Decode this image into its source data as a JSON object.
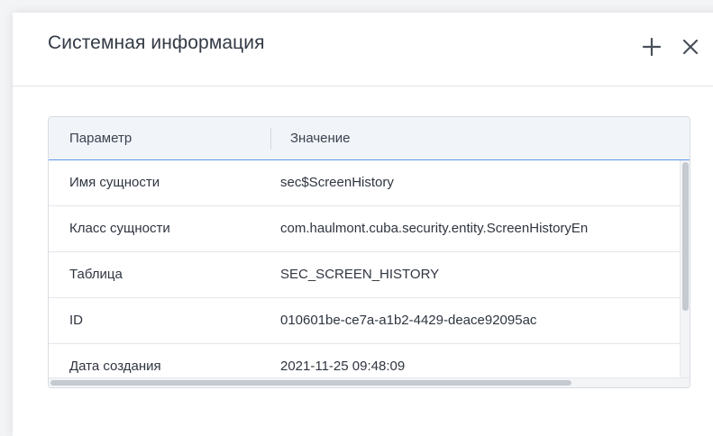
{
  "dialog": {
    "title": "Системная информация",
    "maximize_icon": "plus-icon",
    "close_icon": "close-icon"
  },
  "table": {
    "columns": [
      "Параметр",
      "Значение"
    ],
    "rows": [
      {
        "param": "Имя сущности",
        "value": "sec$ScreenHistory"
      },
      {
        "param": "Класс сущности",
        "value": "com.haulmont.cuba.security.entity.ScreenHistoryEn"
      },
      {
        "param": "Таблица",
        "value": "SEC_SCREEN_HISTORY"
      },
      {
        "param": "ID",
        "value": "010601be-ce7a-a1b2-4429-deace92095ac"
      },
      {
        "param": "Дата создания",
        "value": "2021-11-25 09:48:09"
      }
    ]
  },
  "colors": {
    "header_bg": "#f1f4f9",
    "header_underline": "#5b9be6",
    "text": "#2f3540"
  }
}
